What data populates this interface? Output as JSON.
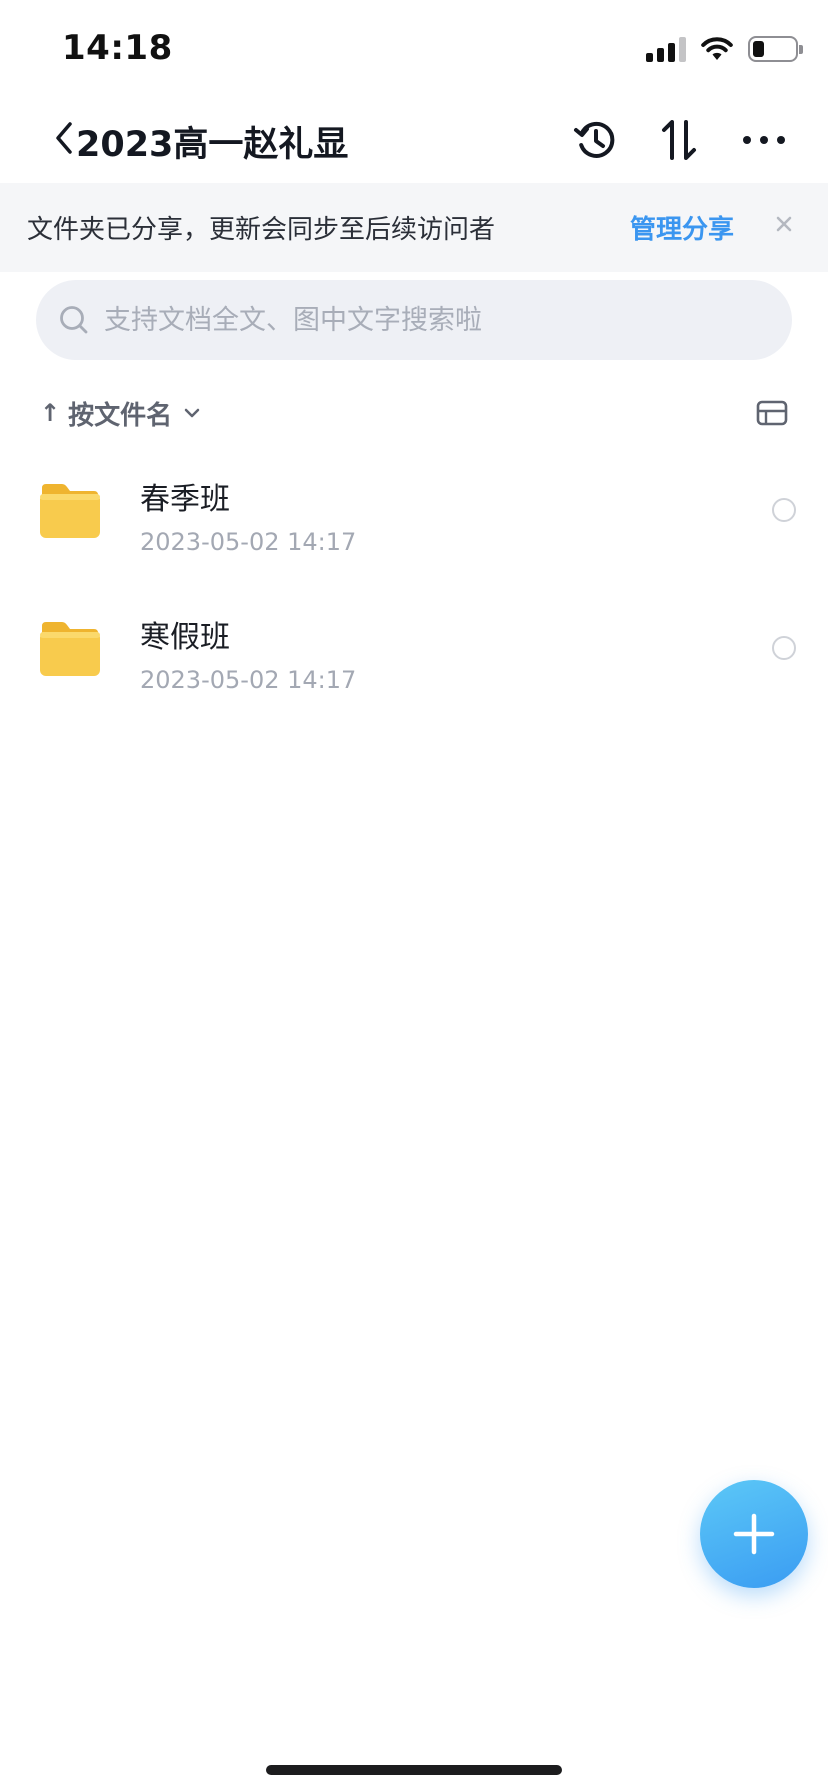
{
  "status_bar": {
    "time": "14:18",
    "icons": [
      "cellular-signal-icon",
      "wifi-icon",
      "battery-icon"
    ]
  },
  "nav": {
    "title": "2023高一赵礼显",
    "icons": [
      "back-chevron-icon",
      "history-icon",
      "sort-icon",
      "more-icon"
    ]
  },
  "share_banner": {
    "message": "文件夹已分享，更新会同步至后续访问者",
    "manage_label": "管理分享",
    "close_icon": "close-icon"
  },
  "search": {
    "placeholder": "支持文档全文、图中文字搜索啦",
    "value": ""
  },
  "sort": {
    "arrow": "↑",
    "label": "按文件名",
    "icon": "chevron-down-icon",
    "view_toggle_icon": "list-view-icon"
  },
  "files": [
    {
      "name": "春季班",
      "date": "2023-05-02 14:17",
      "type": "folder"
    },
    {
      "name": "寒假班",
      "date": "2023-05-02 14:17",
      "type": "folder"
    }
  ],
  "fab": {
    "icon": "plus-icon"
  },
  "colors": {
    "accent": "#3b96f0",
    "folder": "#f7c948",
    "banner_bg": "#f5f6f8",
    "search_bg": "#eef0f5"
  }
}
